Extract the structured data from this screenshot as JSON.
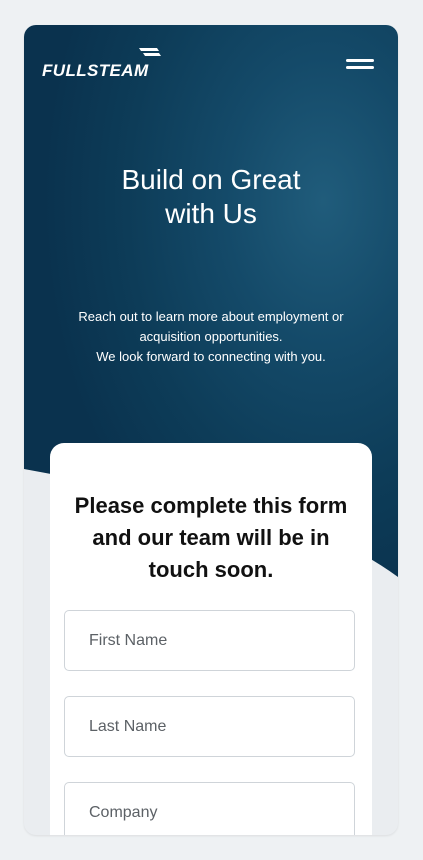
{
  "header": {
    "logo_text": "FULLSTEAM",
    "menu_icon": "hamburger-icon"
  },
  "hero": {
    "title_line1": "Build on Great",
    "title_line2": "with Us",
    "desc_line1": "Reach out to learn more about employment or",
    "desc_line2": "acquisition opportunities.",
    "desc_line3": "We look forward to connecting with you."
  },
  "form": {
    "heading_line1": "Please complete this form",
    "heading_line2": "and our team will be in",
    "heading_line3": "touch soon.",
    "first_name_placeholder": "First Name",
    "last_name_placeholder": "Last Name",
    "company_placeholder": "Company"
  },
  "colors": {
    "hero_background": "#0d3c58",
    "page_background": "#eef1f3",
    "card_background": "#ffffff"
  }
}
